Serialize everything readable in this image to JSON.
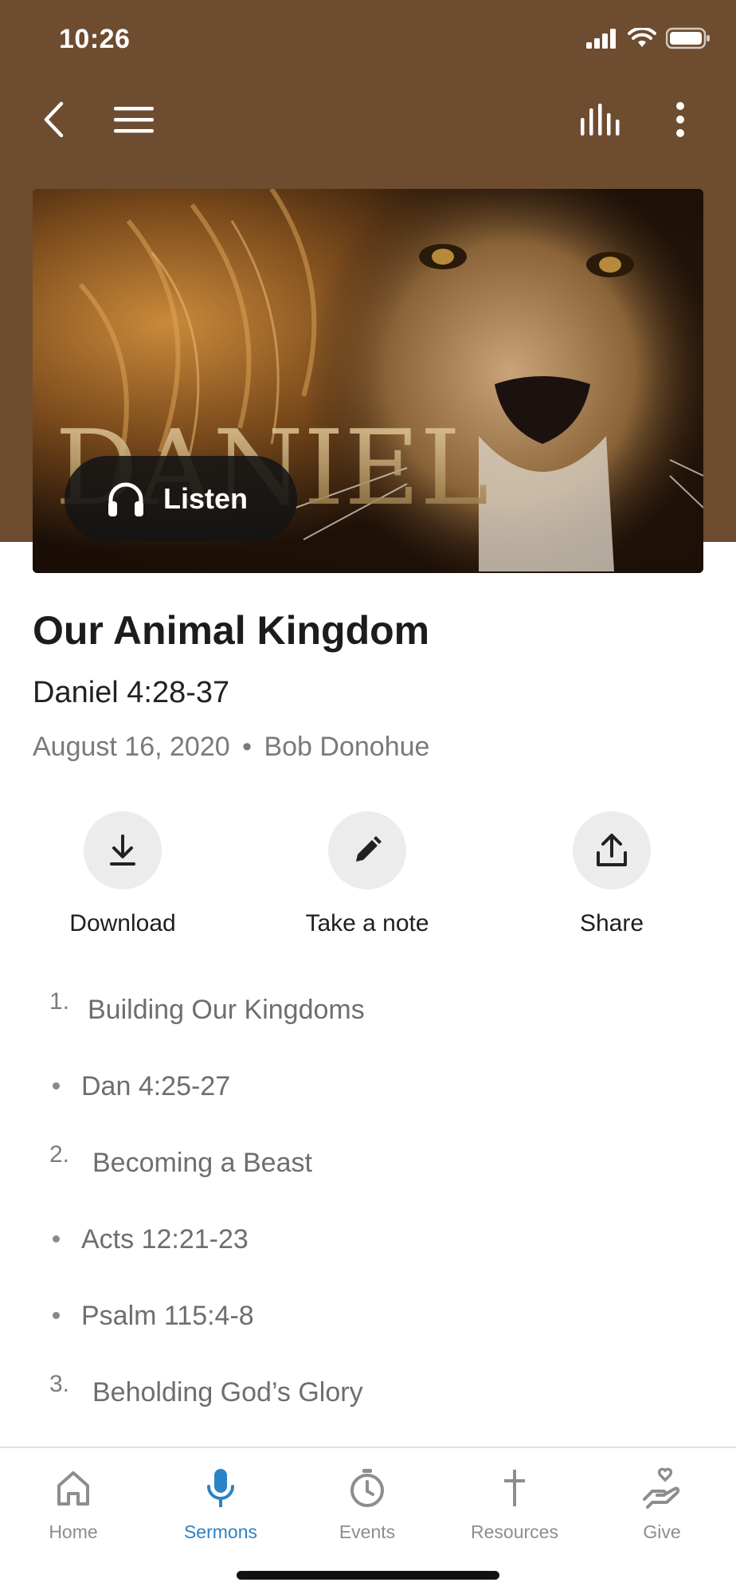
{
  "status_bar": {
    "time": "10:26",
    "icons": [
      "signal-icon",
      "wifi-icon",
      "battery-icon"
    ]
  },
  "top_nav": {
    "icons": [
      "back-chevron-icon",
      "menu-icon",
      "audio-bars-icon",
      "more-vertical-icon"
    ]
  },
  "hero": {
    "image_text": "DANIEL",
    "listen_label": "Listen",
    "listen_icon": "headphones-icon"
  },
  "sermon": {
    "title": "Our Animal Kingdom",
    "scripture": "Daniel 4:28-37",
    "date": "August 16, 2020",
    "separator": "•",
    "speaker": "Bob Donohue"
  },
  "actions": [
    {
      "label": "Download",
      "icon": "download-icon"
    },
    {
      "label": "Take a note",
      "icon": "pencil-icon"
    },
    {
      "label": "Share",
      "icon": "share-icon"
    }
  ],
  "outline": [
    {
      "type": "number",
      "marker": "1.",
      "text": "Building Our Kingdoms"
    },
    {
      "type": "bullet",
      "text": "Dan 4:25-27"
    },
    {
      "type": "number",
      "marker": "2.",
      "text": "Becoming a Beast"
    },
    {
      "type": "bullet",
      "text": "Acts 12:21-23"
    },
    {
      "type": "bullet",
      "text": "Psalm 115:4-8"
    },
    {
      "type": "number",
      "marker": "3.",
      "text": "Beholding God’s Glory"
    }
  ],
  "tabbar": {
    "active": "Sermons",
    "tabs": [
      {
        "label": "Home",
        "icon": "home-icon"
      },
      {
        "label": "Sermons",
        "icon": "microphone-icon"
      },
      {
        "label": "Events",
        "icon": "clock-icon"
      },
      {
        "label": "Resources",
        "icon": "cross-icon"
      },
      {
        "label": "Give",
        "icon": "giving-hand-icon"
      }
    ]
  },
  "colors": {
    "header": "#6e4c30",
    "accent": "#2a83c6",
    "muted": "#8d8d8d"
  }
}
